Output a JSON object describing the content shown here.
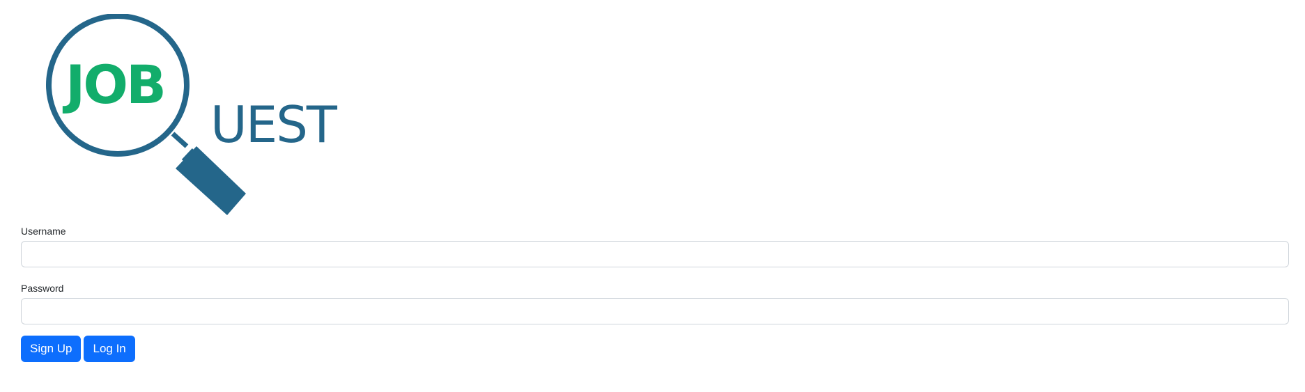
{
  "logo": {
    "text_primary": "JOB",
    "text_secondary": "UEST",
    "colors": {
      "primary": "#24668a",
      "accent": "#12ad6b"
    }
  },
  "form": {
    "username_label": "Username",
    "username_value": "",
    "password_label": "Password",
    "password_value": "",
    "signup_label": "Sign Up",
    "login_label": "Log In"
  },
  "colors": {
    "button": "#0d6efd",
    "input_border": "#ced4da"
  }
}
